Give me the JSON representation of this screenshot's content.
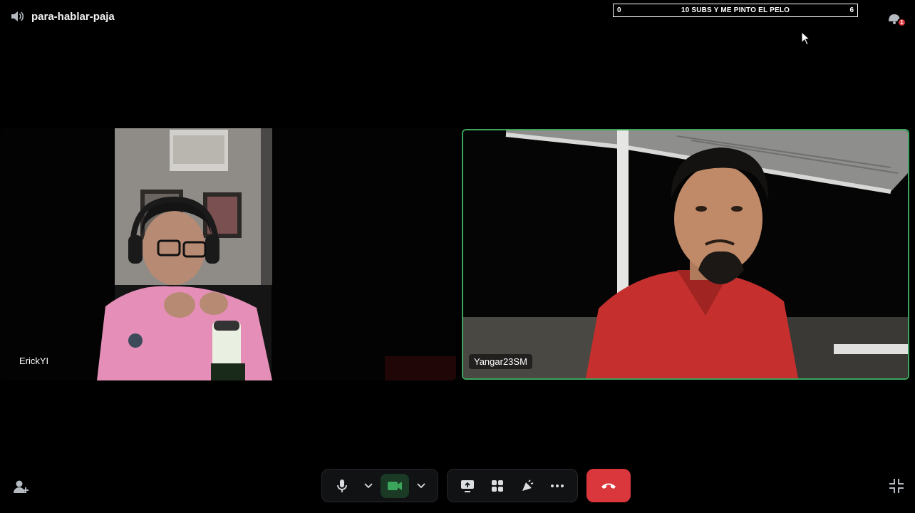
{
  "header": {
    "channel_name": "para-hablar-paja",
    "speaker_icon": "speaker-icon"
  },
  "goal_bar": {
    "start": "0",
    "title": "10 SUBS Y ME PINTO EL PELO",
    "end": "6"
  },
  "inbox": {
    "icon": "inbox-icon",
    "badge": "1"
  },
  "participants": [
    {
      "name": "ErickYI",
      "speaking": false
    },
    {
      "name": "Yangar23SM",
      "speaking": true
    }
  ],
  "controls": {
    "mic_icon": "microphone-icon",
    "camera_icon": "camera-icon",
    "screenshare_icon": "screen-share-icon",
    "activities_icon": "activities-icon",
    "soundboard_icon": "soundboard-icon",
    "more_icon": "more-icon",
    "hangup_icon": "hang-up-icon"
  },
  "colors": {
    "speaking_border": "#3ba55c",
    "hangup": "#da373c",
    "camera_active": "#3ba55c",
    "badge": "#e0393e"
  }
}
